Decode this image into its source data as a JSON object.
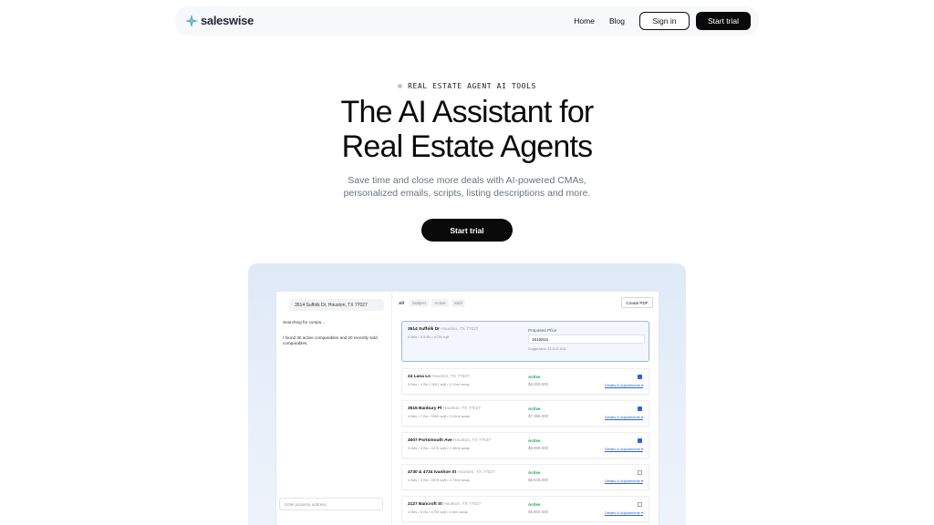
{
  "nav": {
    "brand": "saleswise",
    "links": [
      "Home",
      "Blog"
    ],
    "signin": "Sign in",
    "start_trial": "Start trial"
  },
  "hero": {
    "eyebrow": "REAL ESTATE AGENT AI TOOLS",
    "title_line1": "The AI Assistant for",
    "title_line2": "Real Estate Agents",
    "subtitle_line1": "Save time and close more deals with AI-powered CMAs,",
    "subtitle_line2": "personalized emails, scripts, listing descriptions and more.",
    "cta": "Start trial"
  },
  "demo": {
    "chat": {
      "address_chip": "3514 Suffolk Dr, Houston, TX 77027",
      "message1": "Searching for comps...",
      "message2": "I found 30 active comparables and 20 recently sold comparables.",
      "input_placeholder": "Enter property address"
    },
    "tabs": [
      "All",
      "Subject",
      "Active",
      "Sold"
    ],
    "create_pdf": "Create PDF",
    "subject": {
      "street": "3514 Suffolk Dr",
      "city": "Houston, TX 77027",
      "meta": "5 Bds • 5.5 Bs • 4736 sqft",
      "price_label": "Proposed Price",
      "price_value": "1615815",
      "suggested": "Suggested: $1,615,815"
    },
    "comps": [
      {
        "street": "24 Lana Ln",
        "city": "Houston, TX 77027",
        "meta": "5 Bds • 4 Bs • 3501 sqft • 0.11mi away",
        "status": "Active",
        "price": "$5,000,000",
        "details": "Details & Adjustments ▾",
        "checked": true
      },
      {
        "street": "3515 Banbury Pl",
        "city": "Houston, TX 77027",
        "meta": "4 Bds • 7 Bs • 5300 sqft • 0.24mi away",
        "status": "Active",
        "price": "$7,395,000",
        "details": "Details & Adjustments ▾",
        "checked": true
      },
      {
        "street": "4007 Portsmouth Ave",
        "city": "Houston, TX 77027",
        "meta": "5 Bds • 4 Bs • 4275 sqft • 0.36mi away",
        "status": "Active",
        "price": "$5,599,000",
        "details": "Details & Adjustments ▾",
        "checked": true
      },
      {
        "street": "4730 & 4734 Ivanhoe St",
        "city": "Houston, TX 77027",
        "meta": "4 Bds • 3 Bs • 3578 sqft • 0.73mi away",
        "status": "Active",
        "price": "$5,649,000",
        "details": "Details & Adjustments ▾",
        "checked": false
      },
      {
        "street": "2127 Bancroft St",
        "city": "Houston, TX 77027",
        "meta": "4 Bds • 5 Bs • 4705 sqft • 0.8mi away",
        "status": "Active",
        "price": "$5,800,000",
        "details": "Details & Adjustments ▾",
        "checked": false
      }
    ]
  },
  "icons": {
    "brand": "sparkle-logo-icon"
  },
  "colors": {
    "accent": "#2563eb",
    "active_green": "#16a34a",
    "brand_teal": "#4aa3b5"
  }
}
